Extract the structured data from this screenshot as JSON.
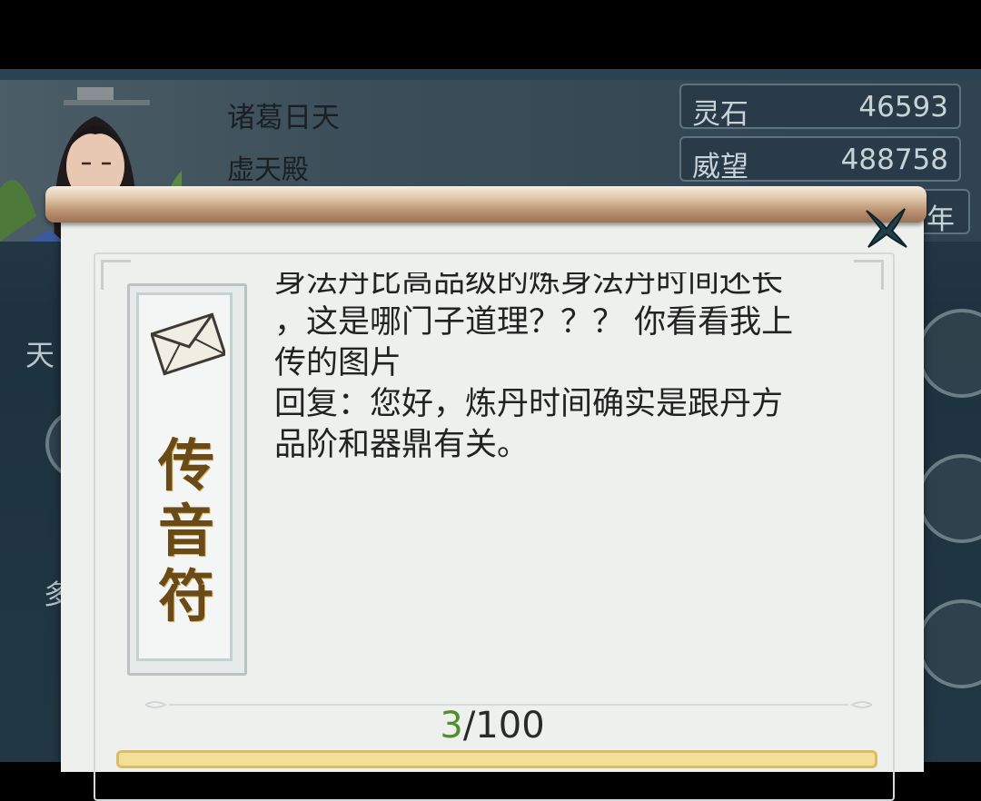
{
  "player": {
    "name": "诸葛日天",
    "sect": "虚天殿"
  },
  "resources": [
    {
      "label": "灵石",
      "value": "46593"
    },
    {
      "label": "威望",
      "value": "488758"
    }
  ],
  "resource_partial": "年",
  "side": {
    "left_char": "天",
    "left_char2": "多"
  },
  "talisman": {
    "chars": [
      "传",
      "音",
      "符"
    ],
    "icon": "envelope-icon"
  },
  "message": {
    "lines": [
      "身法丹比高品级的炼身法丹时间还长",
      "，这是哪门子道理？？？ 你看看我上",
      "传的图片",
      "回复：您好，炼丹时间确实是跟丹方",
      "品阶和器鼎有关。"
    ]
  },
  "counter": {
    "current": "3",
    "total": "/100"
  },
  "colors": {
    "counter_current": "#4f8f2d",
    "talisman_text": "#6a4a17",
    "panel": "#eef0ee"
  }
}
